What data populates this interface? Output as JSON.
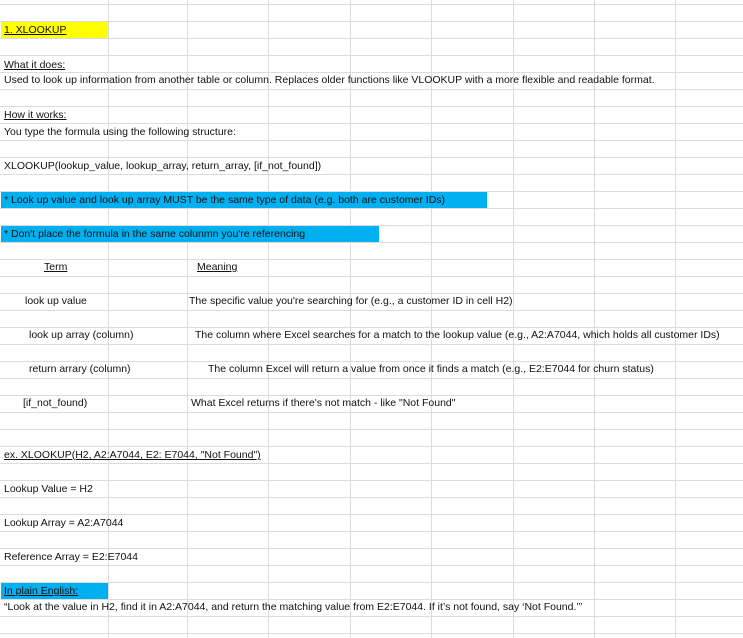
{
  "sheet": {
    "title": "1. XLOOKUP",
    "what_heading": "What it does:",
    "what_text": "Used to look up information from another table or column. Replaces older functions like VLOOKUP with a more flexible and readable format.",
    "how_heading": "How it works:",
    "how_text": "You type the formula using the following structure:",
    "syntax": "XLOOKUP(lookup_value, lookup_array, return_array, [if_not_found])",
    "note1": "* Look up value and look up array MUST be the same type of data (e.g. both are customer IDs)",
    "note2": "* Don't place the formula in the same colunmn you're referencing",
    "table": {
      "col_term": "Term",
      "col_meaning": "Meaning",
      "rows": [
        {
          "term": "look up value",
          "meaning": "The specific value you're searching for (e.g., a customer ID in cell H2)"
        },
        {
          "term": "look up array (column)",
          "meaning": "The column where Excel searches for a match to the lookup value (e.g., A2:A7044, which holds all customer IDs)"
        },
        {
          "term": "return arrary (column)",
          "meaning": "The column Excel will return a value from once it finds a match (e.g., E2:E7044 for churn status)"
        },
        {
          "term": "[if_not_found)",
          "meaning": "What Excel returns if there's not match - like \"Not Found\""
        }
      ]
    },
    "example": "ex. XLOOKUP(H2, A2:A7044, E2: E7044, \"Not Found\")",
    "lookup_value_line": "Lookup Value = H2",
    "lookup_array_line": "Lookup Array = A2:A7044",
    "reference_array_line": "Reference Array = E2:E7044",
    "plain_heading": "In plain English:",
    "plain_text": "“Look at the value in H2, find it in A2:A7044, and return the matching value from E2:E7044. If it’s not found, say ‘Not Found.’”"
  },
  "colors": {
    "title_fill": "#ffff00",
    "note_fill": "#00b0f0",
    "grid": "#dcdcdc"
  }
}
